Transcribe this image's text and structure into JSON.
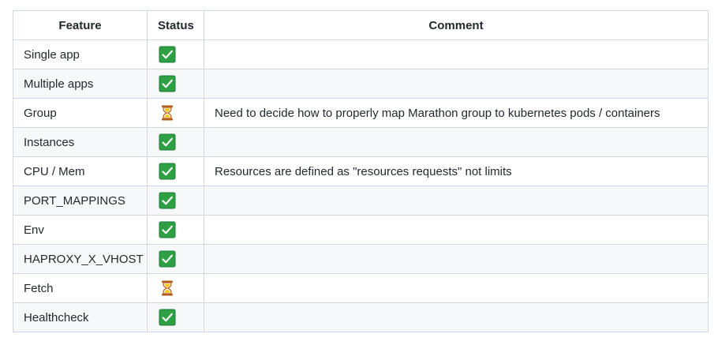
{
  "table": {
    "headers": {
      "feature": "Feature",
      "status": "Status",
      "comment": "Comment"
    },
    "rows": [
      {
        "feature": "Single app",
        "status_icon": "check-mark-icon",
        "comment": ""
      },
      {
        "feature": "Multiple apps",
        "status_icon": "check-mark-icon",
        "comment": ""
      },
      {
        "feature": "Group",
        "status_icon": "hourglass-icon",
        "comment": "Need to decide how to properly map Marathon group to kubernetes pods / containers"
      },
      {
        "feature": "Instances",
        "status_icon": "check-mark-icon",
        "comment": ""
      },
      {
        "feature": "CPU / Mem",
        "status_icon": "check-mark-icon",
        "comment": "Resources are defined as \"resources requests\" not limits"
      },
      {
        "feature": "PORT_MAPPINGS",
        "status_icon": "check-mark-icon",
        "comment": ""
      },
      {
        "feature": "Env",
        "status_icon": "check-mark-icon",
        "comment": ""
      },
      {
        "feature": "HAPROXY_X_VHOST",
        "status_icon": "check-mark-icon",
        "comment": ""
      },
      {
        "feature": "Fetch",
        "status_icon": "hourglass-icon",
        "comment": ""
      },
      {
        "feature": "Healthcheck",
        "status_icon": "check-mark-icon",
        "comment": ""
      }
    ]
  },
  "colors": {
    "check_fill": "#2ea043",
    "check_border": "#1a7f37",
    "hourglass_frame": "#b35c1e",
    "hourglass_sand": "#f5c518",
    "border": "#d0d7de",
    "stripe": "#f6f8fa"
  }
}
